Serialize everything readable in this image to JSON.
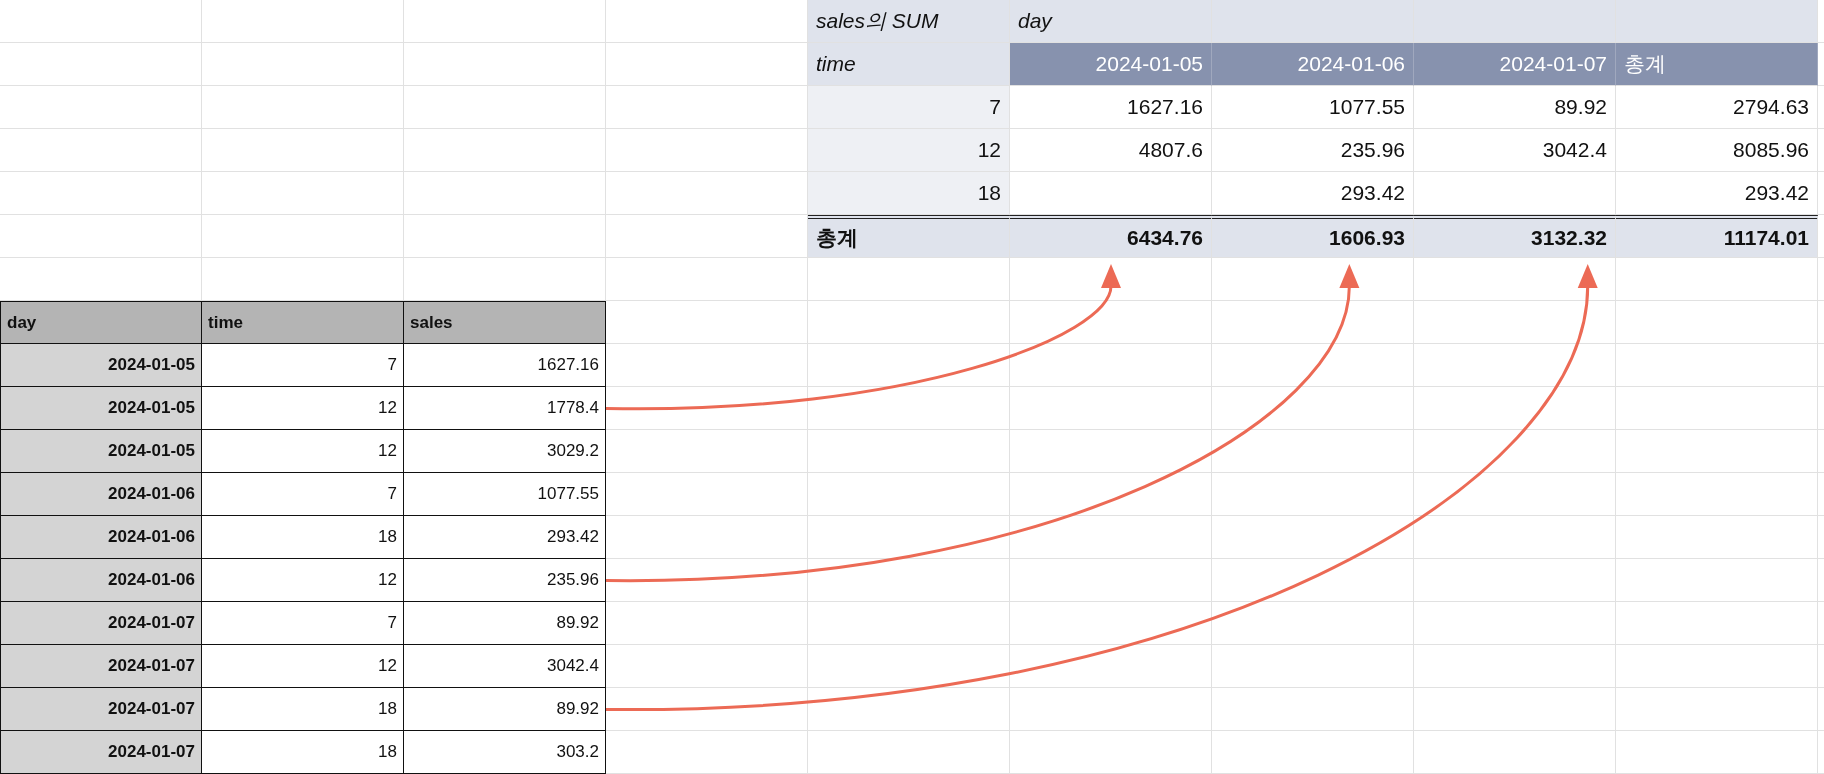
{
  "pivot": {
    "title": "sales의 SUM",
    "column_field": "day",
    "row_field": "time",
    "columns": [
      "2024-01-05",
      "2024-01-06",
      "2024-01-07"
    ],
    "total_label": "총계",
    "rows": [
      {
        "label": "7",
        "values": [
          {
            "kind": "value",
            "value": "1627.16"
          },
          {
            "kind": "value",
            "value": "1077.55"
          },
          {
            "kind": "value",
            "value": "89.92"
          }
        ],
        "total": "2794.63"
      },
      {
        "label": "12",
        "values": [
          {
            "kind": "value",
            "value": "4807.6"
          },
          {
            "kind": "value",
            "value": "235.96"
          },
          {
            "kind": "value",
            "value": "3042.4"
          }
        ],
        "total": "8085.96"
      },
      {
        "label": "18",
        "values": [
          {
            "kind": "empty"
          },
          {
            "kind": "value",
            "value": "293.42"
          },
          {
            "kind": "empty"
          }
        ],
        "total": "293.42"
      }
    ],
    "grand_total": {
      "label": "총계",
      "values": [
        {
          "value": "6434.76",
          "arrow": true
        },
        {
          "value": "1606.93",
          "arrow": true
        },
        {
          "value": "3132.32",
          "arrow": true
        }
      ],
      "total": "11174.01"
    }
  },
  "source": {
    "columns": [
      "day",
      "time",
      "sales"
    ],
    "rows": [
      {
        "cells": [
          "2024-01-05",
          "7",
          "1627.16"
        ],
        "arrow": false
      },
      {
        "cells": [
          "2024-01-05",
          "12",
          "1778.4"
        ],
        "arrow": true
      },
      {
        "cells": [
          "2024-01-05",
          "12",
          "3029.2"
        ],
        "arrow": false
      },
      {
        "cells": [
          "2024-01-06",
          "7",
          "1077.55"
        ],
        "arrow": false
      },
      {
        "cells": [
          "2024-01-06",
          "18",
          "293.42"
        ],
        "arrow": false
      },
      {
        "cells": [
          "2024-01-06",
          "12",
          "235.96"
        ],
        "arrow": true
      },
      {
        "cells": [
          "2024-01-07",
          "7",
          "89.92"
        ],
        "arrow": false
      },
      {
        "cells": [
          "2024-01-07",
          "12",
          "3042.4"
        ],
        "arrow": false
      },
      {
        "cells": [
          "2024-01-07",
          "18",
          "89.92"
        ],
        "arrow": true
      },
      {
        "cells": [
          "2024-01-07",
          "18",
          "303.2"
        ],
        "arrow": false
      }
    ]
  }
}
